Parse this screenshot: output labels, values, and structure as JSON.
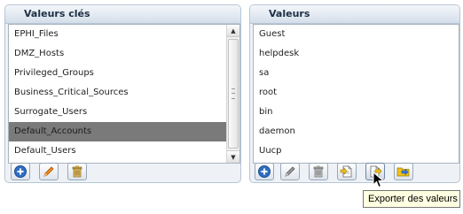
{
  "left_panel": {
    "title": "Valeurs clés",
    "items": [
      {
        "label": "EPHI_Files",
        "selected": false
      },
      {
        "label": "DMZ_Hosts",
        "selected": false
      },
      {
        "label": "Privileged_Groups",
        "selected": false
      },
      {
        "label": "Business_Critical_Sources",
        "selected": false
      },
      {
        "label": "Surrogate_Users",
        "selected": false
      },
      {
        "label": "Default_Accounts",
        "selected": true
      },
      {
        "label": "Default_Users",
        "selected": false
      }
    ],
    "toolbar": [
      {
        "icon": "add-icon"
      },
      {
        "icon": "edit-icon"
      },
      {
        "icon": "delete-icon"
      }
    ]
  },
  "right_panel": {
    "title": "Valeurs",
    "items": [
      {
        "label": "Guest"
      },
      {
        "label": "helpdesk"
      },
      {
        "label": "sa"
      },
      {
        "label": "root"
      },
      {
        "label": "bin"
      },
      {
        "label": "daemon"
      },
      {
        "label": "Uucp"
      }
    ],
    "toolbar": [
      {
        "icon": "add-icon"
      },
      {
        "icon": "edit-icon"
      },
      {
        "icon": "delete-icon"
      },
      {
        "icon": "import-icon"
      },
      {
        "icon": "export-icon"
      },
      {
        "icon": "transfer-icon"
      }
    ]
  },
  "tooltip": {
    "text": "Exporter des valeurs"
  },
  "colors": {
    "selected_row": "#7a7a7a",
    "panel_border": "#b7c6d6",
    "tooltip_bg": "#ffffe1"
  }
}
